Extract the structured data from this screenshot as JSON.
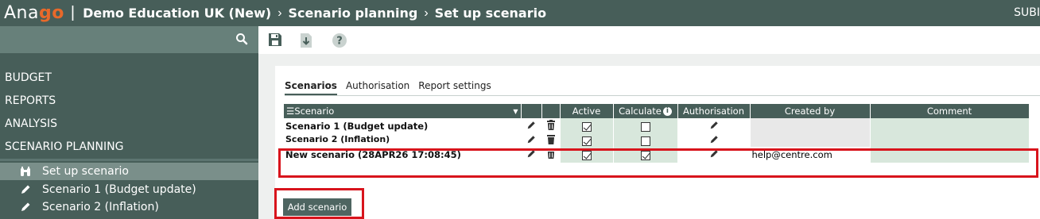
{
  "header": {
    "logo_prefix": "Ana",
    "logo_suffix": "go",
    "breadcrumbs": [
      "Demo Education UK (New)",
      "Scenario planning",
      "Set up scenario"
    ],
    "right_label": "SUBI"
  },
  "sidebar": {
    "menu": [
      "BUDGET",
      "REPORTS",
      "ANALYSIS",
      "SCENARIO PLANNING"
    ],
    "subitems": [
      {
        "label": "Set up scenario",
        "icon": "binoculars-icon",
        "active": true
      },
      {
        "label": "Scenario 1 (Budget update)",
        "icon": "pencil-icon",
        "active": false
      },
      {
        "label": "Scenario 2 (Inflation)",
        "icon": "pencil-icon",
        "active": false
      }
    ]
  },
  "toolbar": {
    "icons": [
      "save-icon",
      "export-icon",
      "help-icon"
    ]
  },
  "tabs": [
    "Scenarios",
    "Authorisation",
    "Report settings"
  ],
  "table": {
    "columns": {
      "scenario": "Scenario",
      "active": "Active",
      "calculate": "Calculate",
      "authorisation": "Authorisation",
      "created_by": "Created by",
      "comment": "Comment"
    },
    "rows": [
      {
        "name": "Scenario 1 (Budget update)",
        "active": true,
        "calculate": false,
        "created_by": "",
        "comment": ""
      },
      {
        "name": "Scenario 2 (Inflation)",
        "active": true,
        "calculate": false,
        "created_by": "",
        "comment": ""
      },
      {
        "name": "New scenario (28APR26 17:08:45)",
        "active": true,
        "calculate": true,
        "created_by": "help@centre.com",
        "comment": ""
      }
    ]
  },
  "add_button": "Add scenario",
  "colors": {
    "brand": "#475e59",
    "accent": "#e8692a",
    "highlight": "#d8141c",
    "cell_green": "#d8e7dc"
  }
}
